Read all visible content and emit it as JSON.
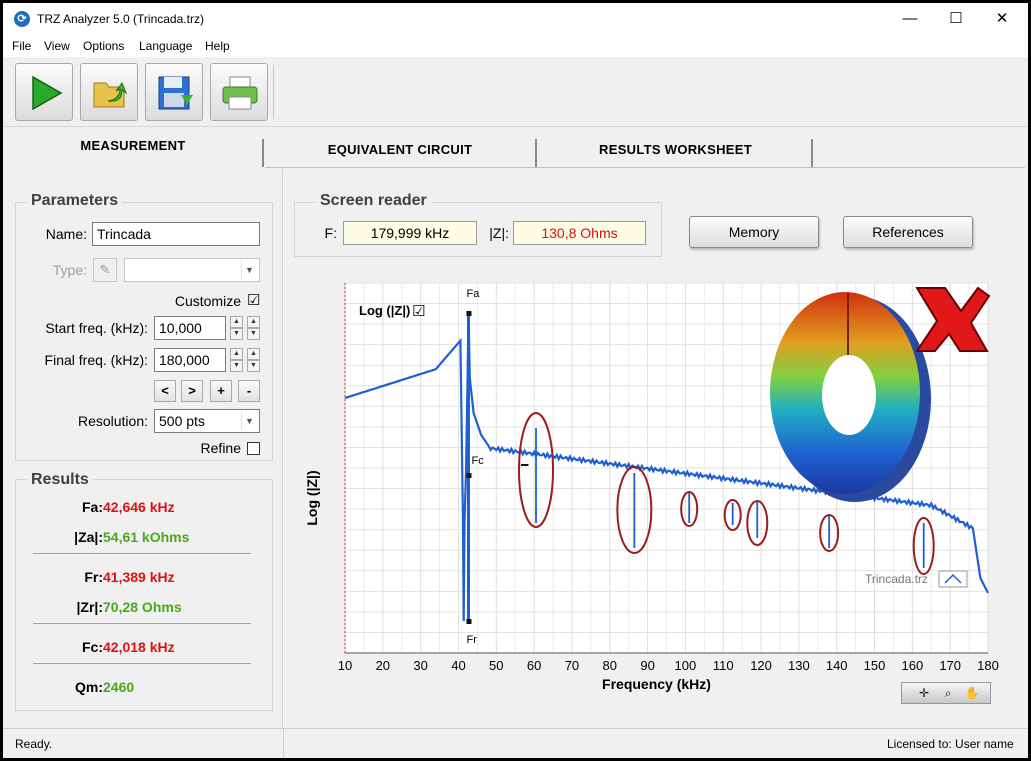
{
  "window": {
    "title": "TRZ Analyzer 5.0 (Trincada.trz)",
    "minimize": "—",
    "maximize": "☐",
    "close": "✕"
  },
  "menu": [
    "File",
    "View",
    "Options",
    "Language",
    "Help"
  ],
  "toolbar": {
    "buttons": [
      {
        "name": "play-icon",
        "color": "#2aa82a"
      },
      {
        "name": "open-folder-icon",
        "color": "#e8c24a"
      },
      {
        "name": "save-icon",
        "color": "#2f6fd0"
      },
      {
        "name": "print-icon",
        "color": "#6fc04a"
      }
    ]
  },
  "tabs": [
    "MEASUREMENT",
    "EQUIVALENT CIRCUIT",
    "RESULTS WORKSHEET"
  ],
  "parameters": {
    "title": "Parameters",
    "name_label": "Name:",
    "name_value": "Trincada",
    "type_label": "Type:",
    "type_value": "",
    "customize_label": "Customize",
    "customize_checked": "☑",
    "start_label": "Start freq. (kHz):",
    "start_value": "10,000",
    "final_label": "Final freq. (kHz):",
    "final_value": "180,000",
    "nav_buttons": [
      "<",
      ">",
      "+",
      "-"
    ],
    "resolution_label": "Resolution:",
    "resolution_value": "500 pts",
    "refine_label": "Refine"
  },
  "results": {
    "title": "Results",
    "rows": [
      {
        "key": "Fa:",
        "value": "42,646 kHz",
        "color": "red"
      },
      {
        "key": "|Za|:",
        "value": "54,61 kOhms",
        "color": "green"
      },
      {
        "key": "Fr:",
        "value": "41,389 kHz",
        "color": "red"
      },
      {
        "key": "|Zr|:",
        "value": "70,28 Ohms",
        "color": "green"
      },
      {
        "key": "Fc:",
        "value": "42,018 kHz",
        "color": "red"
      },
      {
        "key": "Qm:",
        "value": "2460",
        "color": "green"
      }
    ]
  },
  "screen_reader": {
    "title": "Screen reader",
    "f_label": "F:",
    "f_value": "179,999 kHz",
    "z_label": "|Z|:",
    "z_value": "130,8 Ohms"
  },
  "buttons": {
    "memory": "Memory",
    "references": "References"
  },
  "chart_data": {
    "type": "line",
    "xlabel": "Frequency (kHz)",
    "ylabel": "Log (|Z|)",
    "xlim": [
      10,
      180
    ],
    "xticks": [
      10,
      20,
      30,
      40,
      50,
      60,
      70,
      80,
      90,
      100,
      110,
      120,
      130,
      140,
      150,
      160,
      170,
      180
    ],
    "log_label": "Log (|Z|)",
    "log_checked": "☑",
    "markers": [
      "Fa",
      "Fc",
      "Fr"
    ],
    "file_label": "Trincada.trz",
    "series_color": "#1f5fcf",
    "highlight_color": "#9b1c1c",
    "highlighted_peaks_khz": [
      60.5,
      86.5,
      101,
      112.5,
      119,
      138,
      163
    ]
  },
  "status": {
    "left": "Ready.",
    "right": "Licensed to: User name"
  }
}
